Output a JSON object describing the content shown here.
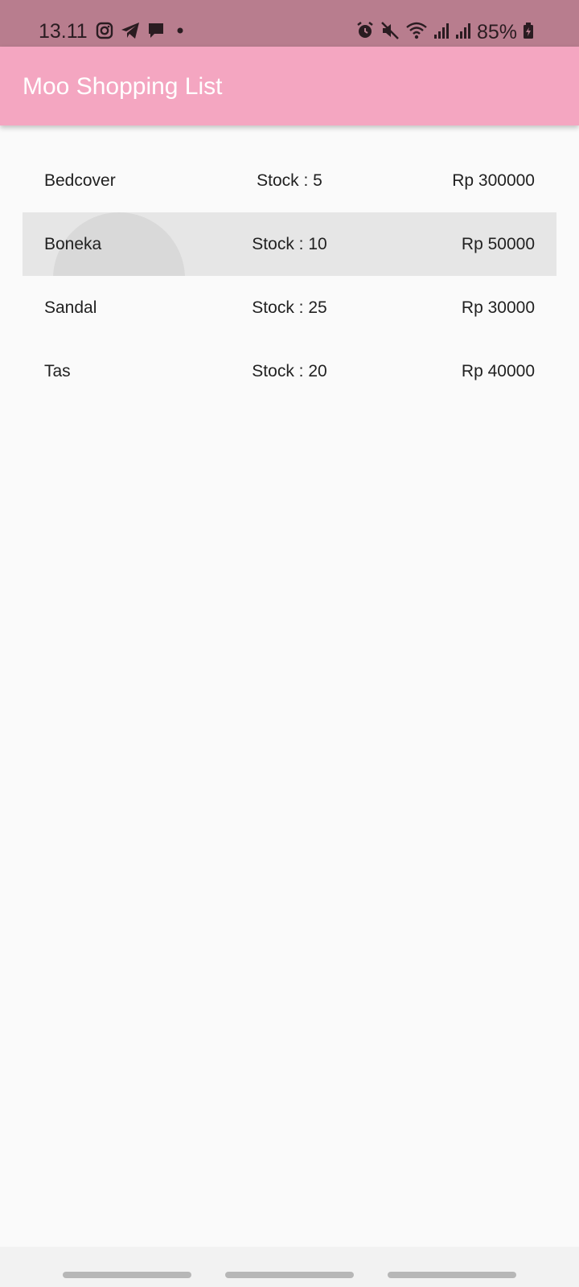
{
  "status_bar": {
    "time": "13.11",
    "battery": "85%",
    "left_icons": [
      "instagram-icon",
      "telegram-icon",
      "chat-icon",
      "dot-icon"
    ],
    "right_icons": [
      "alarm-icon",
      "mute-icon",
      "wifi-icon",
      "signal-icon",
      "signal-icon",
      "battery-charging-icon"
    ]
  },
  "app_bar": {
    "title": "Moo Shopping List",
    "color": "#f4a6c1"
  },
  "items": [
    {
      "name": "Bedcover",
      "stock": "Stock : 5",
      "price": "Rp 300000"
    },
    {
      "name": "Boneka",
      "stock": "Stock : 10",
      "price": "Rp 50000"
    },
    {
      "name": "Sandal",
      "stock": "Stock : 25",
      "price": "Rp 30000"
    },
    {
      "name": "Tas",
      "stock": "Stock : 20",
      "price": "Rp 40000"
    }
  ]
}
